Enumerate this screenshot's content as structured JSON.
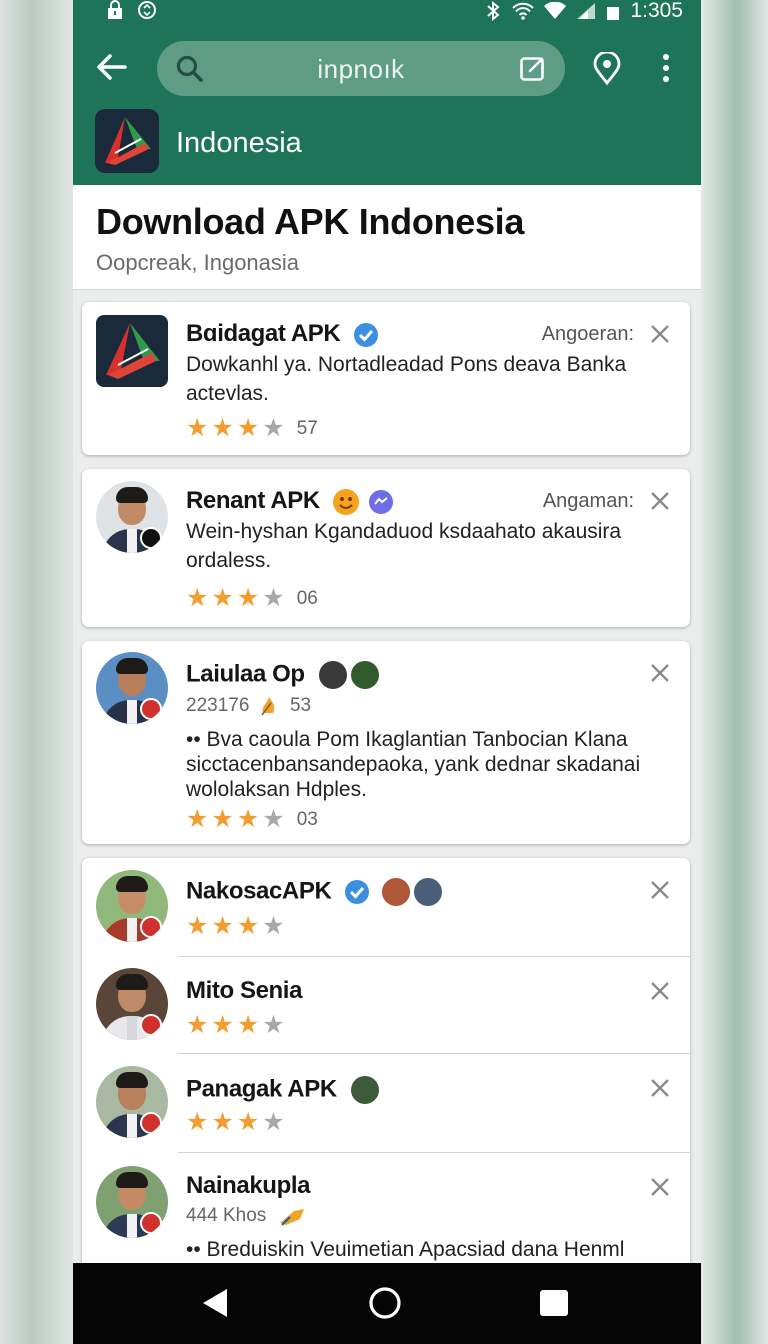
{
  "status_bar": {
    "time": "1:305"
  },
  "search": {
    "query": "inpnoık"
  },
  "app": {
    "name": "Indonesia"
  },
  "header": {
    "title": "Download APK Indonesia",
    "subtitle": "Oopcreak, Ingonasia"
  },
  "cards": [
    {
      "name": "Bɑidagat APK",
      "meta": "Angoeran:",
      "desc": "Dowkanhl ya. Nortadleadad Pons deava Banka actevlas.",
      "rating": 3,
      "count": "57"
    },
    {
      "name": "Renant APK",
      "meta": "Angaman:",
      "desc": "Wein-hyshan Kgandaduod ksdaahato akausira ordaless.",
      "rating": 3,
      "count": "06"
    },
    {
      "name": "Laiulaa Op",
      "stat_a": "223176",
      "stat_b": "53",
      "desc": "•• Bva caoula Pom Ikaglantian Tanbocian Klana sicctacenbansandepaoka, yank dednar skadanai wololaksan Hdples.",
      "rating": 3,
      "count": "03"
    },
    {
      "name": "NakosacAPK",
      "rating": 3
    },
    {
      "name": "Mito Senia",
      "rating": 3
    },
    {
      "name": "Panagak APK",
      "rating": 3
    },
    {
      "name": "Nainakupla",
      "stat_a": "444 Khos",
      "desc": "•• Breduiskin Veuimetian Apacsiad dana Henml"
    }
  ],
  "colors": {
    "app_bar": "#1e7458",
    "star_on": "#f39c2f",
    "star_off": "#a8a8a8",
    "verified": "#3b8fe0"
  }
}
